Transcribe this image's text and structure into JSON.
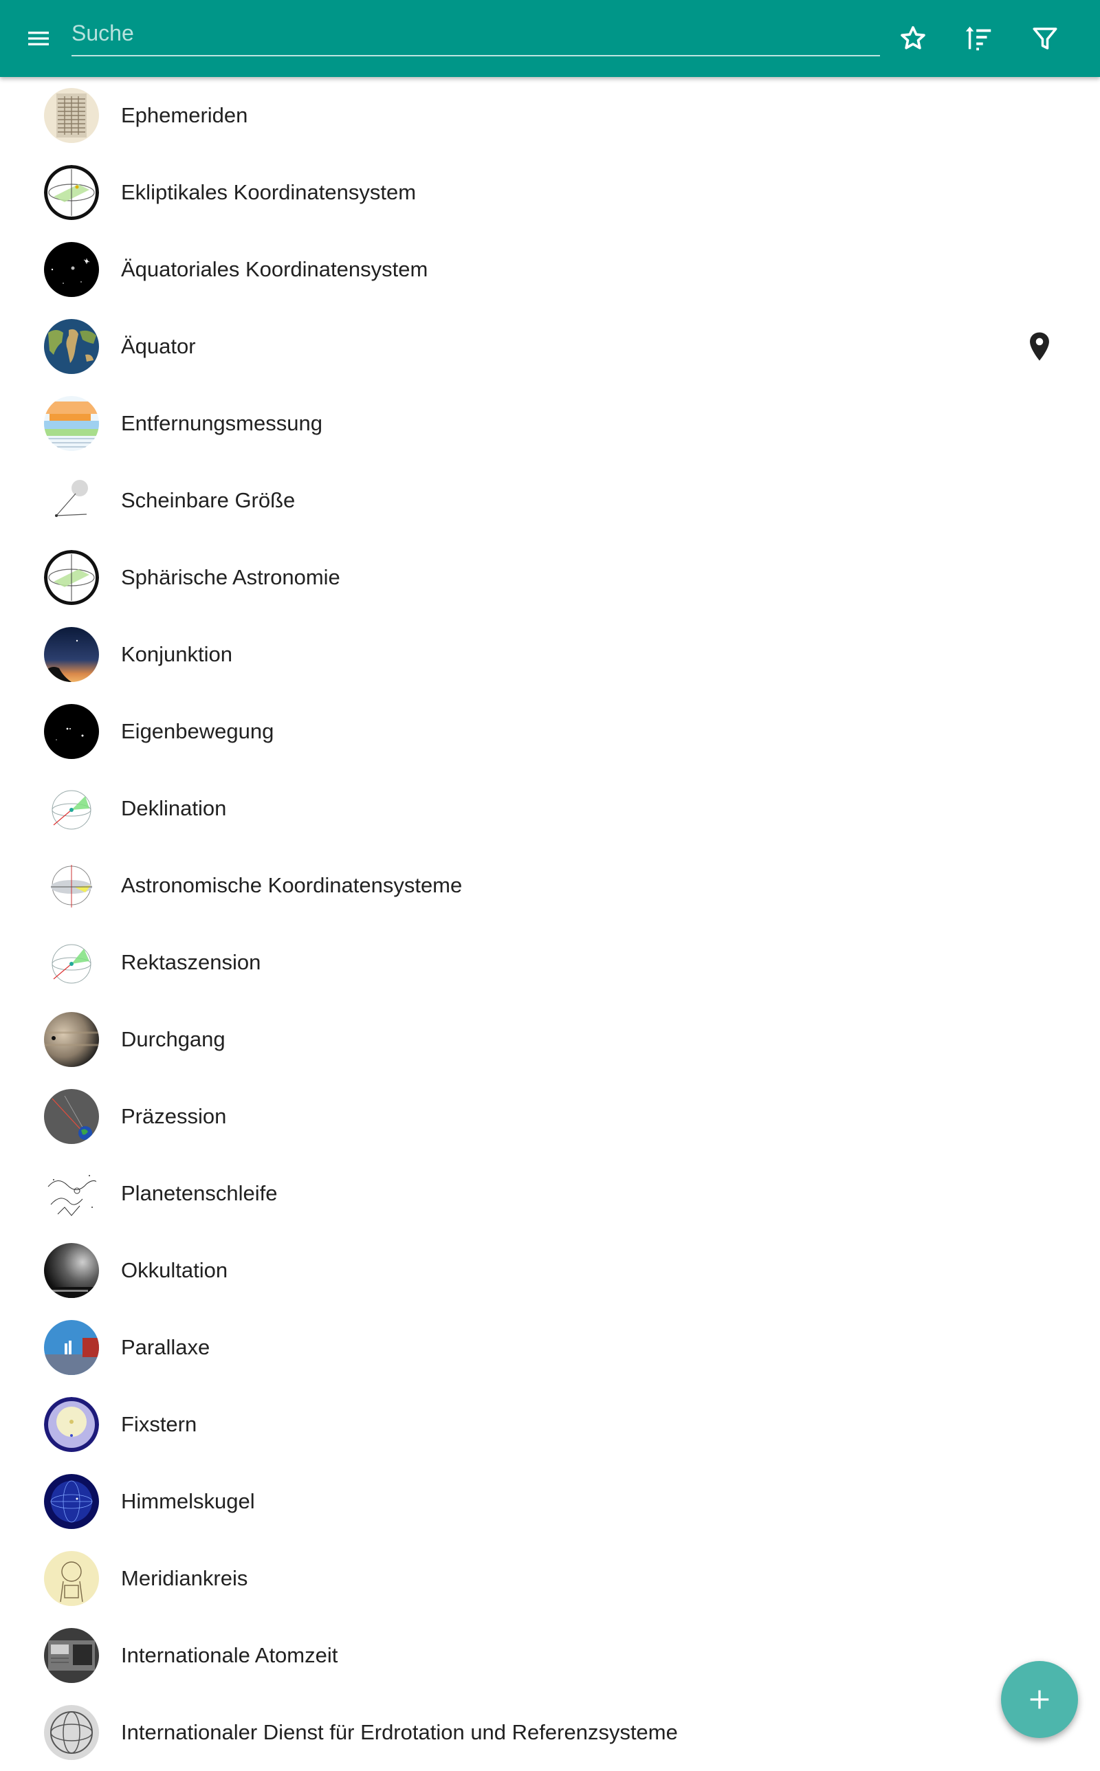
{
  "search": {
    "placeholder": "Suche"
  },
  "toolbar": {
    "icons": [
      "menu-icon",
      "star-icon",
      "sort-icon",
      "filter-icon"
    ],
    "color": "#009688"
  },
  "items": [
    {
      "label": "Ephemeriden",
      "icon": "ephemeris-thumbnail"
    },
    {
      "label": "Ekliptikales Koordinatensystem",
      "icon": "ecliptic-diagram-thumbnail"
    },
    {
      "label": "Äquatoriales Koordinatensystem",
      "icon": "night-sky-thumbnail"
    },
    {
      "label": "Äquator",
      "icon": "earth-map-thumbnail",
      "marker": "location-pin-icon"
    },
    {
      "label": "Entfernungsmessung",
      "icon": "distance-chart-thumbnail"
    },
    {
      "label": "Scheinbare Größe",
      "icon": "apparent-size-thumbnail"
    },
    {
      "label": "Sphärische Astronomie",
      "icon": "celestial-diagram-thumbnail"
    },
    {
      "label": "Konjunktion",
      "icon": "twilight-sky-thumbnail"
    },
    {
      "label": "Eigenbewegung",
      "icon": "star-field-thumbnail"
    },
    {
      "label": "Deklination",
      "icon": "declination-diagram-thumbnail"
    },
    {
      "label": "Astronomische Koordinatensysteme",
      "icon": "coordinate-systems-thumbnail"
    },
    {
      "label": "Rektaszension",
      "icon": "right-ascension-diagram-thumbnail"
    },
    {
      "label": "Durchgang",
      "icon": "planet-transit-thumbnail"
    },
    {
      "label": "Präzession",
      "icon": "precession-thumbnail"
    },
    {
      "label": "Planetenschleife",
      "icon": "planet-loop-sketch-thumbnail"
    },
    {
      "label": "Okkultation",
      "icon": "occultation-thumbnail"
    },
    {
      "label": "Parallaxe",
      "icon": "parallax-thumbnail"
    },
    {
      "label": "Fixstern",
      "icon": "fixed-star-thumbnail"
    },
    {
      "label": "Himmelskugel",
      "icon": "celestial-sphere-thumbnail"
    },
    {
      "label": "Meridiankreis",
      "icon": "meridian-circle-thumbnail"
    },
    {
      "label": "Internationale Atomzeit",
      "icon": "atomic-clock-thumbnail"
    },
    {
      "label": "Internationaler Dienst für Erdrotation und Referenzsysteme",
      "icon": "earth-rotation-thumbnail"
    }
  ],
  "fab": {
    "icon": "add-icon",
    "color": "#4db6ac"
  }
}
